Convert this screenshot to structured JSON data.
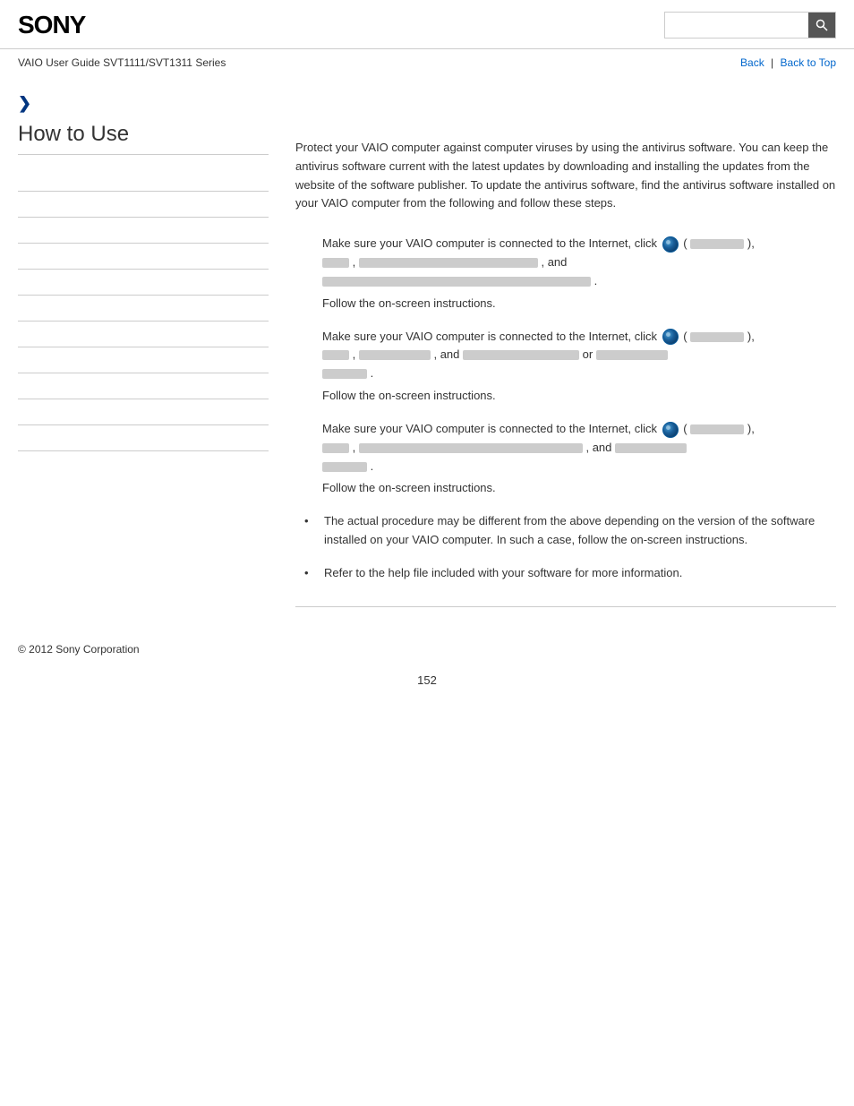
{
  "header": {
    "logo": "SONY",
    "search_placeholder": ""
  },
  "breadcrumb": {
    "guide": "VAIO User Guide SVT1111/SVT1311 Series",
    "back_label": "Back",
    "back_to_top_label": "Back to Top"
  },
  "sidebar": {
    "arrow": "❯",
    "title": "How to Use",
    "nav_items": [
      {
        "label": ""
      },
      {
        "label": ""
      },
      {
        "label": ""
      },
      {
        "label": ""
      },
      {
        "label": ""
      },
      {
        "label": ""
      },
      {
        "label": ""
      },
      {
        "label": ""
      },
      {
        "label": ""
      },
      {
        "label": ""
      },
      {
        "label": ""
      }
    ]
  },
  "main": {
    "intro": "Protect your VAIO computer against computer viruses by using the antivirus software. You can keep the antivirus software current with the latest updates by downloading and installing the updates from the website of the software publisher. To update the antivirus software, find the antivirus software installed on your VAIO computer from the following and follow these steps.",
    "step1_text": "Make sure your VAIO computer is connected to the Internet, click",
    "step1_paren_open": "(",
    "step1_paren_close": "),",
    "step1_and": ", and",
    "step1_follow": "Follow the on-screen instructions.",
    "step2_text": "Make sure your VAIO computer is connected to the Internet, click",
    "step2_paren_open": "(",
    "step2_paren_close": "),",
    "step2_and": ", and",
    "step2_or": "or",
    "step2_follow": "Follow the on-screen instructions.",
    "step3_text": "Make sure your VAIO computer is connected to the Internet, click",
    "step3_paren_open": "(",
    "step3_paren_close": "),",
    "step3_and": ", and",
    "step3_follow": "Follow the on-screen instructions.",
    "bullet1": "The actual procedure may be different from the above depending on the version of the software installed on your VAIO computer. In such a case, follow the on-screen instructions.",
    "bullet2": "Refer to the help file included with your software for more information."
  },
  "footer": {
    "copyright": "© 2012 Sony Corporation"
  },
  "page_number": "152"
}
